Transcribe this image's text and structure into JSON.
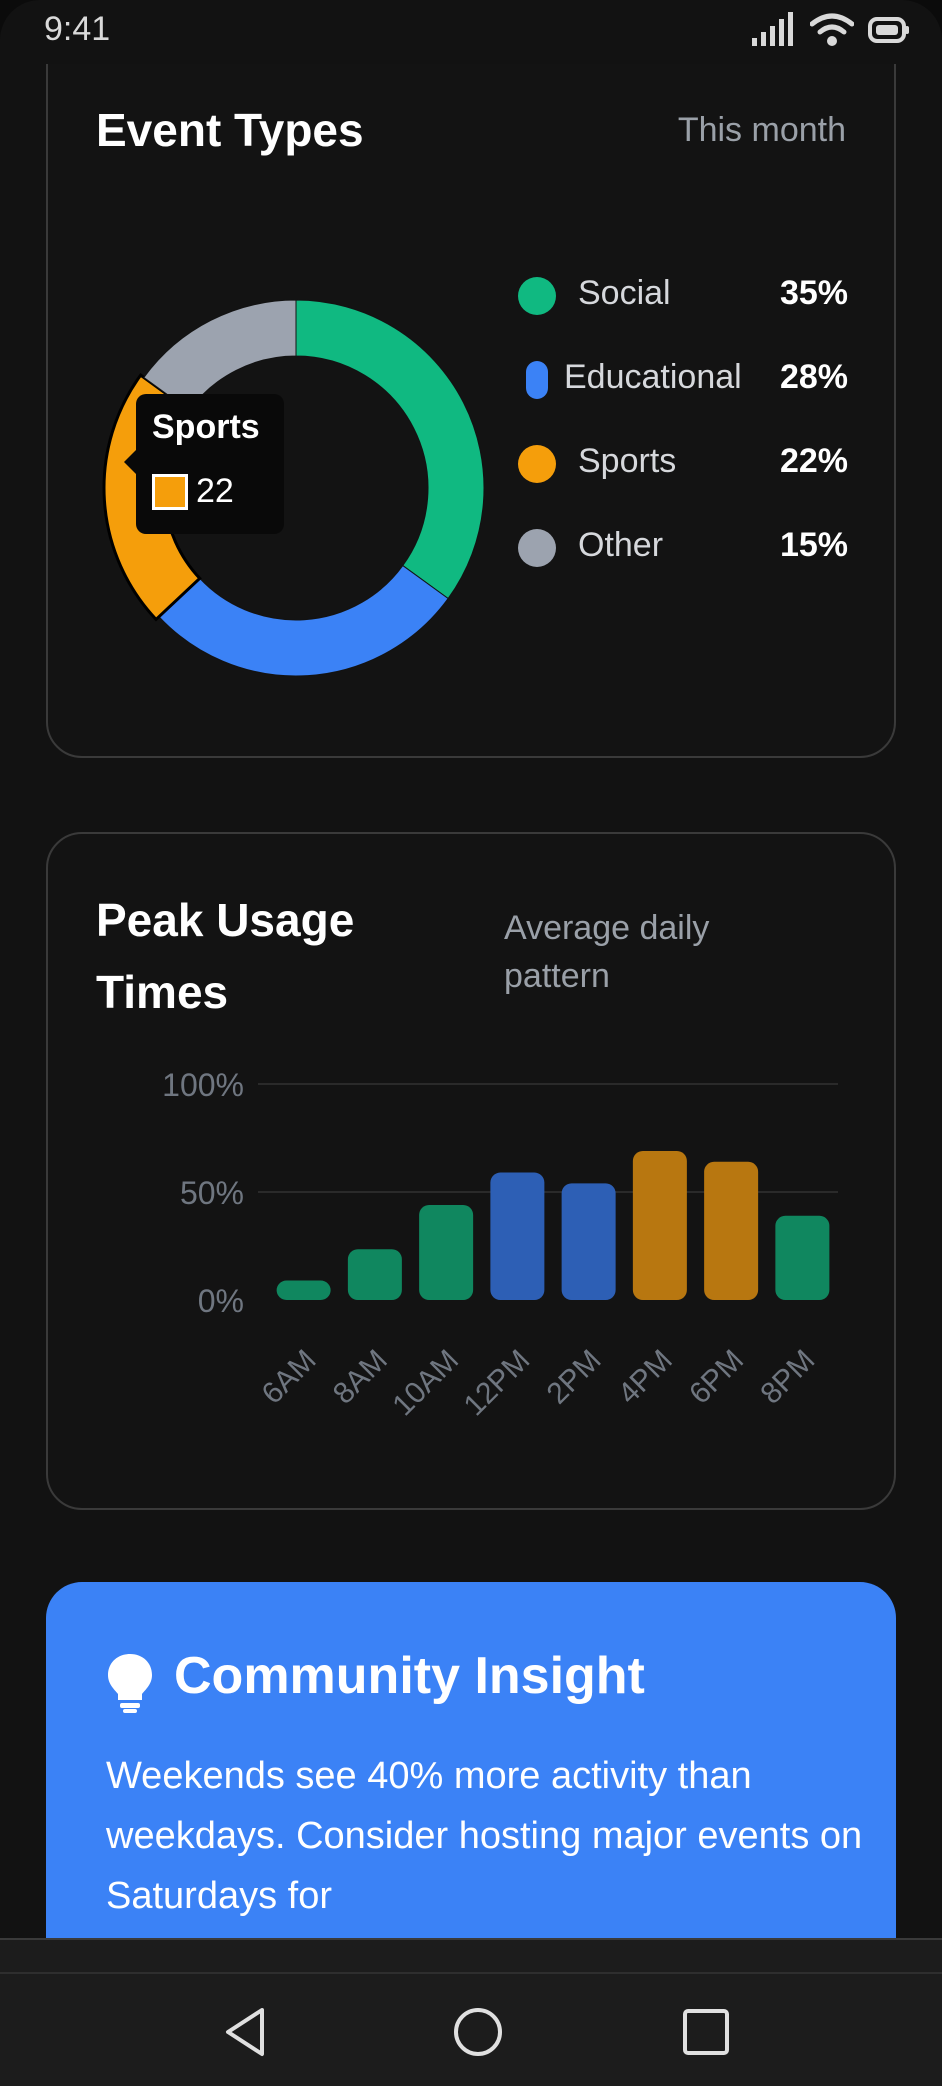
{
  "status_bar": {
    "time": "9:41"
  },
  "event_types": {
    "title": "Event Types",
    "period": "This month",
    "legend": [
      {
        "label": "Social",
        "value": "35%",
        "color": "#10b981"
      },
      {
        "label": "Educational",
        "value": "28%",
        "color": "#3b82f6"
      },
      {
        "label": "Sports",
        "value": "22%",
        "color": "#f59e0b"
      },
      {
        "label": "Other",
        "value": "15%",
        "color": "#9ca3af"
      }
    ],
    "tooltip": {
      "title": "Sports",
      "value": "22"
    }
  },
  "peak_usage": {
    "title_line1": "Peak Usage",
    "title_line2": "Times",
    "subtitle_line1": "Average daily",
    "subtitle_line2": "pattern"
  },
  "insight": {
    "icon": "lightbulb-icon",
    "title": "Community Insight",
    "text": "Weekends see 40% more activity than weekdays. Consider hosting major events on Saturdays for"
  },
  "nav": {
    "back_icon": "back-triangle-icon",
    "home_icon": "home-circle-icon",
    "recents_icon": "recents-square-icon"
  },
  "chart_data": [
    {
      "type": "pie",
      "variant": "donut",
      "categories": [
        "Social",
        "Educational",
        "Sports",
        "Other"
      ],
      "values": [
        35,
        28,
        22,
        15
      ],
      "colors": [
        "#10b981",
        "#3b82f6",
        "#f59e0b",
        "#9ca3af"
      ],
      "highlighted": "Sports",
      "legend": "right"
    },
    {
      "type": "bar",
      "categories": [
        "6AM",
        "8AM",
        "10AM",
        "12PM",
        "2PM",
        "4PM",
        "6PM",
        "8PM"
      ],
      "values": [
        18,
        47,
        88,
        118,
        108,
        138,
        128,
        78
      ],
      "colors": [
        "#10875f",
        "#10875f",
        "#10875f",
        "#2d5fb5",
        "#2d5fb5",
        "#b87710",
        "#b87710",
        "#10875f"
      ],
      "ytick_labels": [
        "0%",
        "50%",
        "100%"
      ],
      "ylim": [
        0,
        200
      ],
      "grid": true
    }
  ]
}
